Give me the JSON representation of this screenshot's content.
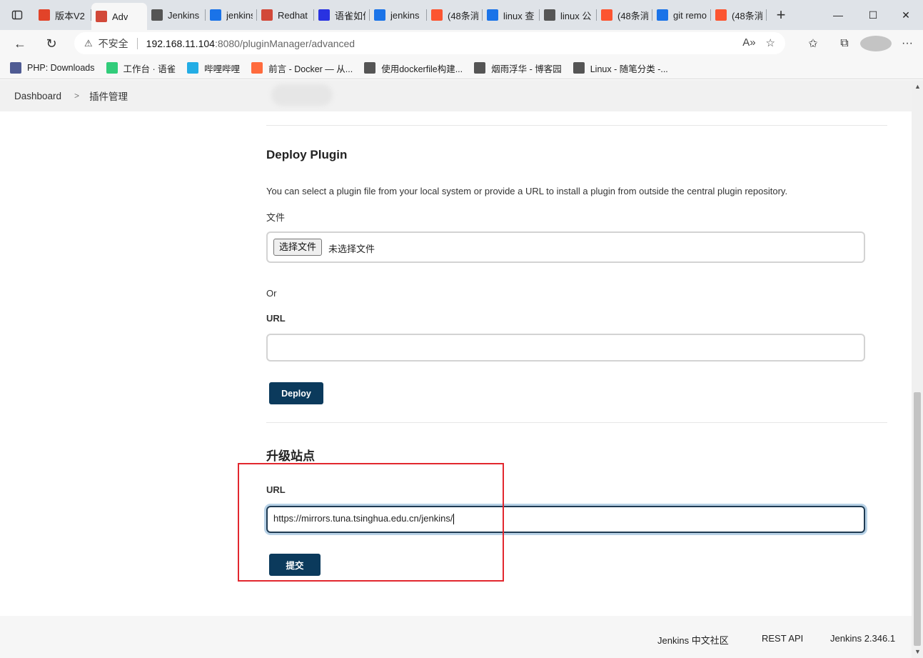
{
  "browser": {
    "tabs": [
      {
        "label": "版本V2",
        "icon": "gitlab-icon",
        "color": "#e24329"
      },
      {
        "label": "Adv",
        "icon": "jenkins-icon",
        "color": "#d24939",
        "active": true
      },
      {
        "label": "Jenkins",
        "icon": "cnblogs-icon",
        "color": "#555555"
      },
      {
        "label": "jenkins",
        "icon": "search-icon",
        "color": "#1a73e8"
      },
      {
        "label": "Redhat",
        "icon": "jenkins-icon",
        "color": "#d24939"
      },
      {
        "label": "语雀如何",
        "icon": "baidu-icon",
        "color": "#2932e1"
      },
      {
        "label": "jenkins",
        "icon": "search-icon",
        "color": "#1a73e8"
      },
      {
        "label": "(48条消",
        "icon": "csdn-icon",
        "color": "#fc5531"
      },
      {
        "label": "linux 查",
        "icon": "search-icon",
        "color": "#1a73e8"
      },
      {
        "label": "linux 公",
        "icon": "cnblogs-icon",
        "color": "#555555"
      },
      {
        "label": "(48条消",
        "icon": "csdn-icon",
        "color": "#fc5531"
      },
      {
        "label": "git remo",
        "icon": "search-icon",
        "color": "#1a73e8"
      },
      {
        "label": "(48条消",
        "icon": "csdn-icon",
        "color": "#fc5531"
      }
    ],
    "address": {
      "security_label": "不安全",
      "host": "192.168.11.104",
      "path": ":8080/pluginManager/advanced"
    },
    "bookmarks": [
      {
        "label": "PHP: Downloads",
        "icon": "php-icon",
        "color": "#4f5b93"
      },
      {
        "label": "工作台 · 语雀",
        "icon": "yuque-icon",
        "color": "#31cc7a"
      },
      {
        "label": "哔哩哔哩",
        "icon": "bilibili-icon",
        "color": "#23ade5"
      },
      {
        "label": "前言 - Docker — 从...",
        "icon": "rocket-icon",
        "color": "#ff6b3d"
      },
      {
        "label": "使用dockerfile构建...",
        "icon": "cnblogs-icon",
        "color": "#555555"
      },
      {
        "label": "烟雨浮华 - 博客园",
        "icon": "cnblogs-icon",
        "color": "#555555"
      },
      {
        "label": "Linux - 随笔分类 -...",
        "icon": "cnblogs-icon",
        "color": "#555555"
      }
    ]
  },
  "breadcrumb": {
    "home": "Dashboard",
    "current": "插件管理"
  },
  "deploy": {
    "title": "Deploy Plugin",
    "description": "You can select a plugin file from your local system or provide a URL to install a plugin from outside the central plugin repository.",
    "file_label": "文件",
    "choose_file_button": "选择文件",
    "no_file_text": "未选择文件",
    "or_text": "Or",
    "url_label": "URL",
    "url_value": "",
    "deploy_button": "Deploy"
  },
  "update_site": {
    "title": "升级站点",
    "url_label": "URL",
    "url_value": "https://mirrors.tuna.tsinghua.edu.cn/jenkins/",
    "submit_button": "提交"
  },
  "footer": {
    "community": "Jenkins 中文社区",
    "rest_api": "REST API",
    "version": "Jenkins 2.346.1"
  },
  "colors": {
    "primary_button": "#0b3a5c",
    "highlight_box": "#e2272e",
    "focus_ring": "#b7d1e6"
  }
}
